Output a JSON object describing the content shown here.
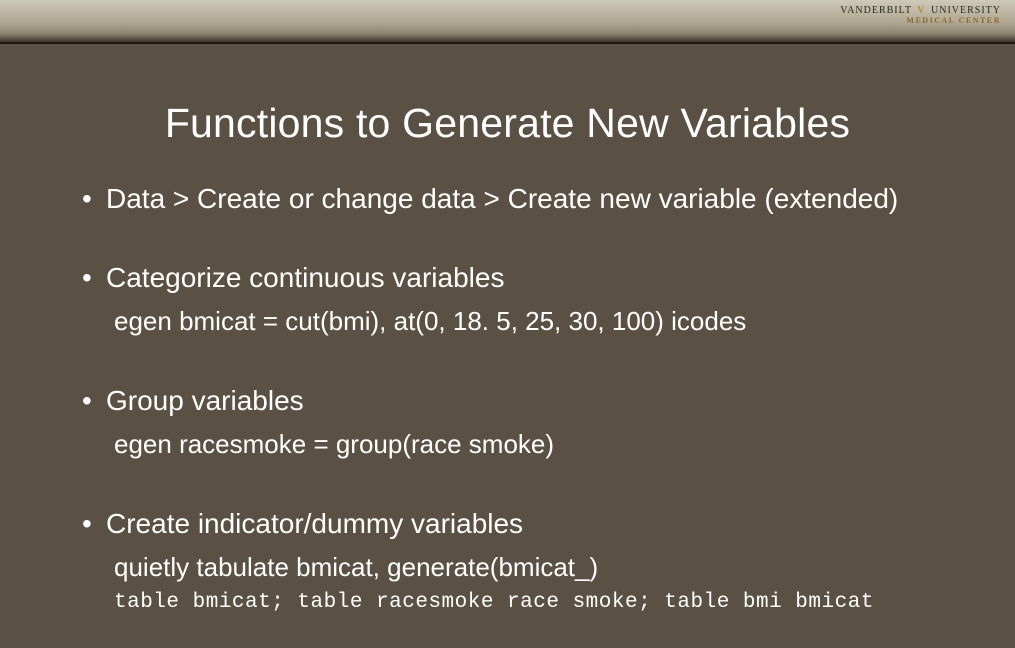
{
  "logo": {
    "line1_left": "VANDERBILT",
    "line1_v": "V",
    "line1_right": "UNIVERSITY",
    "line2": "MEDICAL CENTER"
  },
  "slide": {
    "title": "Functions to Generate New Variables",
    "bullets": [
      {
        "text": "Data > Create or change data > Create new variable (extended)",
        "sub": null,
        "mono": null
      },
      {
        "text": "Categorize continuous variables",
        "sub": "egen bmicat = cut(bmi), at(0, 18. 5, 25, 30, 100) icodes",
        "mono": null
      },
      {
        "text": "Group variables",
        "sub": "egen racesmoke = group(race smoke)",
        "mono": null
      },
      {
        "text": "Create indicator/dummy variables",
        "sub": "quietly tabulate bmicat, generate(bmicat_)",
        "mono": "table bmicat; table racesmoke race smoke; table bmi bmicat"
      }
    ]
  }
}
